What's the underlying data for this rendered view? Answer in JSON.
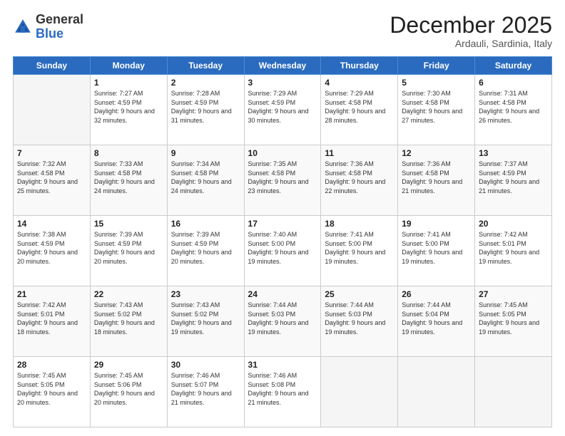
{
  "logo": {
    "general": "General",
    "blue": "Blue"
  },
  "header": {
    "month": "December 2025",
    "location": "Ardauli, Sardinia, Italy"
  },
  "days_of_week": [
    "Sunday",
    "Monday",
    "Tuesday",
    "Wednesday",
    "Thursday",
    "Friday",
    "Saturday"
  ],
  "weeks": [
    [
      {
        "day": "",
        "sunrise": "",
        "sunset": "",
        "daylight": ""
      },
      {
        "day": "1",
        "sunrise": "7:27 AM",
        "sunset": "4:59 PM",
        "daylight": "9 hours and 32 minutes."
      },
      {
        "day": "2",
        "sunrise": "7:28 AM",
        "sunset": "4:59 PM",
        "daylight": "9 hours and 31 minutes."
      },
      {
        "day": "3",
        "sunrise": "7:29 AM",
        "sunset": "4:59 PM",
        "daylight": "9 hours and 30 minutes."
      },
      {
        "day": "4",
        "sunrise": "7:29 AM",
        "sunset": "4:58 PM",
        "daylight": "9 hours and 28 minutes."
      },
      {
        "day": "5",
        "sunrise": "7:30 AM",
        "sunset": "4:58 PM",
        "daylight": "9 hours and 27 minutes."
      },
      {
        "day": "6",
        "sunrise": "7:31 AM",
        "sunset": "4:58 PM",
        "daylight": "9 hours and 26 minutes."
      }
    ],
    [
      {
        "day": "7",
        "sunrise": "7:32 AM",
        "sunset": "4:58 PM",
        "daylight": "9 hours and 25 minutes."
      },
      {
        "day": "8",
        "sunrise": "7:33 AM",
        "sunset": "4:58 PM",
        "daylight": "9 hours and 24 minutes."
      },
      {
        "day": "9",
        "sunrise": "7:34 AM",
        "sunset": "4:58 PM",
        "daylight": "9 hours and 24 minutes."
      },
      {
        "day": "10",
        "sunrise": "7:35 AM",
        "sunset": "4:58 PM",
        "daylight": "9 hours and 23 minutes."
      },
      {
        "day": "11",
        "sunrise": "7:36 AM",
        "sunset": "4:58 PM",
        "daylight": "9 hours and 22 minutes."
      },
      {
        "day": "12",
        "sunrise": "7:36 AM",
        "sunset": "4:58 PM",
        "daylight": "9 hours and 21 minutes."
      },
      {
        "day": "13",
        "sunrise": "7:37 AM",
        "sunset": "4:59 PM",
        "daylight": "9 hours and 21 minutes."
      }
    ],
    [
      {
        "day": "14",
        "sunrise": "7:38 AM",
        "sunset": "4:59 PM",
        "daylight": "9 hours and 20 minutes."
      },
      {
        "day": "15",
        "sunrise": "7:39 AM",
        "sunset": "4:59 PM",
        "daylight": "9 hours and 20 minutes."
      },
      {
        "day": "16",
        "sunrise": "7:39 AM",
        "sunset": "4:59 PM",
        "daylight": "9 hours and 20 minutes."
      },
      {
        "day": "17",
        "sunrise": "7:40 AM",
        "sunset": "5:00 PM",
        "daylight": "9 hours and 19 minutes."
      },
      {
        "day": "18",
        "sunrise": "7:41 AM",
        "sunset": "5:00 PM",
        "daylight": "9 hours and 19 minutes."
      },
      {
        "day": "19",
        "sunrise": "7:41 AM",
        "sunset": "5:00 PM",
        "daylight": "9 hours and 19 minutes."
      },
      {
        "day": "20",
        "sunrise": "7:42 AM",
        "sunset": "5:01 PM",
        "daylight": "9 hours and 19 minutes."
      }
    ],
    [
      {
        "day": "21",
        "sunrise": "7:42 AM",
        "sunset": "5:01 PM",
        "daylight": "9 hours and 18 minutes."
      },
      {
        "day": "22",
        "sunrise": "7:43 AM",
        "sunset": "5:02 PM",
        "daylight": "9 hours and 18 minutes."
      },
      {
        "day": "23",
        "sunrise": "7:43 AM",
        "sunset": "5:02 PM",
        "daylight": "9 hours and 19 minutes."
      },
      {
        "day": "24",
        "sunrise": "7:44 AM",
        "sunset": "5:03 PM",
        "daylight": "9 hours and 19 minutes."
      },
      {
        "day": "25",
        "sunrise": "7:44 AM",
        "sunset": "5:03 PM",
        "daylight": "9 hours and 19 minutes."
      },
      {
        "day": "26",
        "sunrise": "7:44 AM",
        "sunset": "5:04 PM",
        "daylight": "9 hours and 19 minutes."
      },
      {
        "day": "27",
        "sunrise": "7:45 AM",
        "sunset": "5:05 PM",
        "daylight": "9 hours and 19 minutes."
      }
    ],
    [
      {
        "day": "28",
        "sunrise": "7:45 AM",
        "sunset": "5:05 PM",
        "daylight": "9 hours and 20 minutes."
      },
      {
        "day": "29",
        "sunrise": "7:45 AM",
        "sunset": "5:06 PM",
        "daylight": "9 hours and 20 minutes."
      },
      {
        "day": "30",
        "sunrise": "7:46 AM",
        "sunset": "5:07 PM",
        "daylight": "9 hours and 21 minutes."
      },
      {
        "day": "31",
        "sunrise": "7:46 AM",
        "sunset": "5:08 PM",
        "daylight": "9 hours and 21 minutes."
      },
      {
        "day": "",
        "sunrise": "",
        "sunset": "",
        "daylight": ""
      },
      {
        "day": "",
        "sunrise": "",
        "sunset": "",
        "daylight": ""
      },
      {
        "day": "",
        "sunrise": "",
        "sunset": "",
        "daylight": ""
      }
    ]
  ]
}
